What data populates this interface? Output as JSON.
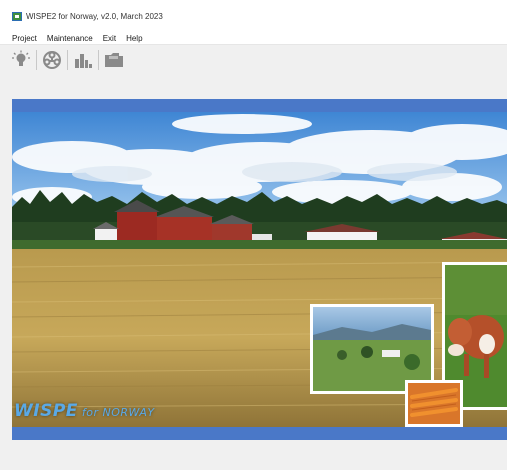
{
  "window": {
    "title": "WISPE2 for Norway, v2.0, March 2023"
  },
  "menu": {
    "items": [
      "Project",
      "Maintenance",
      "Exit",
      "Help"
    ]
  },
  "toolbar": {
    "icons": [
      "lightbulb-icon",
      "network-icon",
      "bar-chart-icon",
      "folder-icon"
    ]
  },
  "banner": {
    "logo_main": "WISPE",
    "logo_sub": "for NORWAY"
  },
  "status": {
    "text": ""
  },
  "colors": {
    "accent_band": "#4a78c8",
    "logo": "#5aa9e6",
    "toolbar_icon": "#8a8a8a"
  }
}
